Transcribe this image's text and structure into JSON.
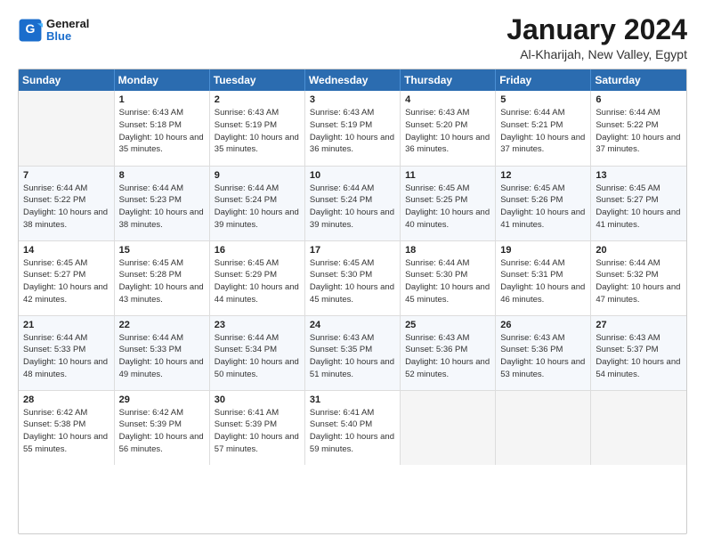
{
  "header": {
    "logo_line1": "General",
    "logo_line2": "Blue",
    "main_title": "January 2024",
    "subtitle": "Al-Kharijah, New Valley, Egypt"
  },
  "calendar": {
    "days_header": [
      "Sunday",
      "Monday",
      "Tuesday",
      "Wednesday",
      "Thursday",
      "Friday",
      "Saturday"
    ],
    "weeks": [
      [
        {
          "num": "",
          "sunrise": "",
          "sunset": "",
          "daylight": ""
        },
        {
          "num": "1",
          "sunrise": "Sunrise: 6:43 AM",
          "sunset": "Sunset: 5:18 PM",
          "daylight": "Daylight: 10 hours and 35 minutes."
        },
        {
          "num": "2",
          "sunrise": "Sunrise: 6:43 AM",
          "sunset": "Sunset: 5:19 PM",
          "daylight": "Daylight: 10 hours and 35 minutes."
        },
        {
          "num": "3",
          "sunrise": "Sunrise: 6:43 AM",
          "sunset": "Sunset: 5:19 PM",
          "daylight": "Daylight: 10 hours and 36 minutes."
        },
        {
          "num": "4",
          "sunrise": "Sunrise: 6:43 AM",
          "sunset": "Sunset: 5:20 PM",
          "daylight": "Daylight: 10 hours and 36 minutes."
        },
        {
          "num": "5",
          "sunrise": "Sunrise: 6:44 AM",
          "sunset": "Sunset: 5:21 PM",
          "daylight": "Daylight: 10 hours and 37 minutes."
        },
        {
          "num": "6",
          "sunrise": "Sunrise: 6:44 AM",
          "sunset": "Sunset: 5:22 PM",
          "daylight": "Daylight: 10 hours and 37 minutes."
        }
      ],
      [
        {
          "num": "7",
          "sunrise": "Sunrise: 6:44 AM",
          "sunset": "Sunset: 5:22 PM",
          "daylight": "Daylight: 10 hours and 38 minutes."
        },
        {
          "num": "8",
          "sunrise": "Sunrise: 6:44 AM",
          "sunset": "Sunset: 5:23 PM",
          "daylight": "Daylight: 10 hours and 38 minutes."
        },
        {
          "num": "9",
          "sunrise": "Sunrise: 6:44 AM",
          "sunset": "Sunset: 5:24 PM",
          "daylight": "Daylight: 10 hours and 39 minutes."
        },
        {
          "num": "10",
          "sunrise": "Sunrise: 6:44 AM",
          "sunset": "Sunset: 5:24 PM",
          "daylight": "Daylight: 10 hours and 39 minutes."
        },
        {
          "num": "11",
          "sunrise": "Sunrise: 6:45 AM",
          "sunset": "Sunset: 5:25 PM",
          "daylight": "Daylight: 10 hours and 40 minutes."
        },
        {
          "num": "12",
          "sunrise": "Sunrise: 6:45 AM",
          "sunset": "Sunset: 5:26 PM",
          "daylight": "Daylight: 10 hours and 41 minutes."
        },
        {
          "num": "13",
          "sunrise": "Sunrise: 6:45 AM",
          "sunset": "Sunset: 5:27 PM",
          "daylight": "Daylight: 10 hours and 41 minutes."
        }
      ],
      [
        {
          "num": "14",
          "sunrise": "Sunrise: 6:45 AM",
          "sunset": "Sunset: 5:27 PM",
          "daylight": "Daylight: 10 hours and 42 minutes."
        },
        {
          "num": "15",
          "sunrise": "Sunrise: 6:45 AM",
          "sunset": "Sunset: 5:28 PM",
          "daylight": "Daylight: 10 hours and 43 minutes."
        },
        {
          "num": "16",
          "sunrise": "Sunrise: 6:45 AM",
          "sunset": "Sunset: 5:29 PM",
          "daylight": "Daylight: 10 hours and 44 minutes."
        },
        {
          "num": "17",
          "sunrise": "Sunrise: 6:45 AM",
          "sunset": "Sunset: 5:30 PM",
          "daylight": "Daylight: 10 hours and 45 minutes."
        },
        {
          "num": "18",
          "sunrise": "Sunrise: 6:44 AM",
          "sunset": "Sunset: 5:30 PM",
          "daylight": "Daylight: 10 hours and 45 minutes."
        },
        {
          "num": "19",
          "sunrise": "Sunrise: 6:44 AM",
          "sunset": "Sunset: 5:31 PM",
          "daylight": "Daylight: 10 hours and 46 minutes."
        },
        {
          "num": "20",
          "sunrise": "Sunrise: 6:44 AM",
          "sunset": "Sunset: 5:32 PM",
          "daylight": "Daylight: 10 hours and 47 minutes."
        }
      ],
      [
        {
          "num": "21",
          "sunrise": "Sunrise: 6:44 AM",
          "sunset": "Sunset: 5:33 PM",
          "daylight": "Daylight: 10 hours and 48 minutes."
        },
        {
          "num": "22",
          "sunrise": "Sunrise: 6:44 AM",
          "sunset": "Sunset: 5:33 PM",
          "daylight": "Daylight: 10 hours and 49 minutes."
        },
        {
          "num": "23",
          "sunrise": "Sunrise: 6:44 AM",
          "sunset": "Sunset: 5:34 PM",
          "daylight": "Daylight: 10 hours and 50 minutes."
        },
        {
          "num": "24",
          "sunrise": "Sunrise: 6:43 AM",
          "sunset": "Sunset: 5:35 PM",
          "daylight": "Daylight: 10 hours and 51 minutes."
        },
        {
          "num": "25",
          "sunrise": "Sunrise: 6:43 AM",
          "sunset": "Sunset: 5:36 PM",
          "daylight": "Daylight: 10 hours and 52 minutes."
        },
        {
          "num": "26",
          "sunrise": "Sunrise: 6:43 AM",
          "sunset": "Sunset: 5:36 PM",
          "daylight": "Daylight: 10 hours and 53 minutes."
        },
        {
          "num": "27",
          "sunrise": "Sunrise: 6:43 AM",
          "sunset": "Sunset: 5:37 PM",
          "daylight": "Daylight: 10 hours and 54 minutes."
        }
      ],
      [
        {
          "num": "28",
          "sunrise": "Sunrise: 6:42 AM",
          "sunset": "Sunset: 5:38 PM",
          "daylight": "Daylight: 10 hours and 55 minutes."
        },
        {
          "num": "29",
          "sunrise": "Sunrise: 6:42 AM",
          "sunset": "Sunset: 5:39 PM",
          "daylight": "Daylight: 10 hours and 56 minutes."
        },
        {
          "num": "30",
          "sunrise": "Sunrise: 6:41 AM",
          "sunset": "Sunset: 5:39 PM",
          "daylight": "Daylight: 10 hours and 57 minutes."
        },
        {
          "num": "31",
          "sunrise": "Sunrise: 6:41 AM",
          "sunset": "Sunset: 5:40 PM",
          "daylight": "Daylight: 10 hours and 59 minutes."
        },
        {
          "num": "",
          "sunrise": "",
          "sunset": "",
          "daylight": ""
        },
        {
          "num": "",
          "sunrise": "",
          "sunset": "",
          "daylight": ""
        },
        {
          "num": "",
          "sunrise": "",
          "sunset": "",
          "daylight": ""
        }
      ]
    ]
  }
}
